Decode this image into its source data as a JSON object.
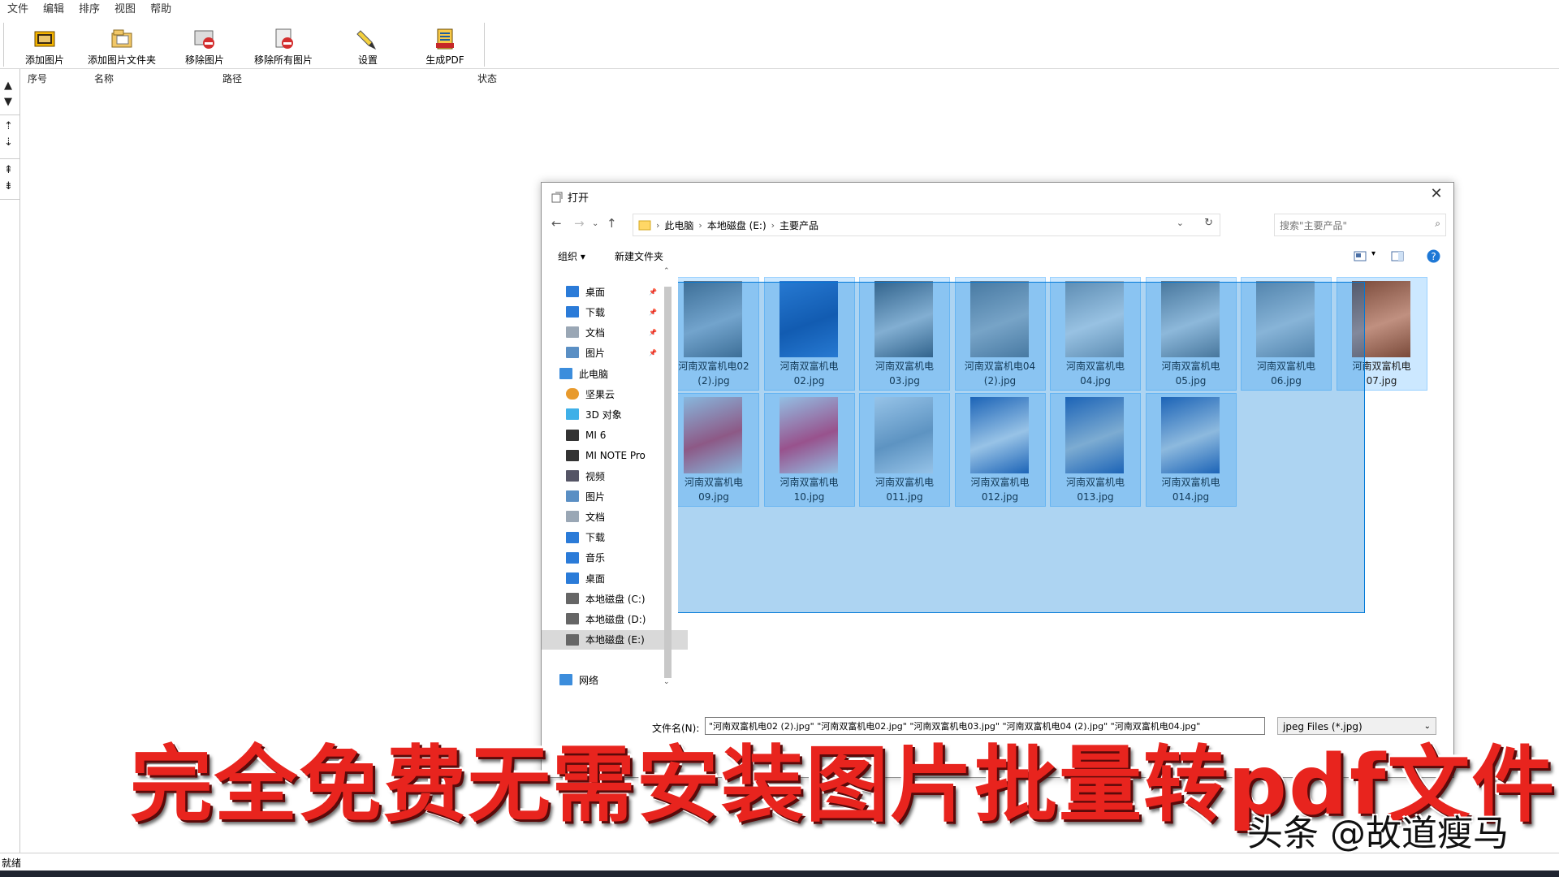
{
  "menu": [
    "文件",
    "编辑",
    "排序",
    "视图",
    "帮助"
  ],
  "toolbar": {
    "add_image": "添加图片",
    "add_folder": "添加图片文件夹",
    "remove_image": "移除图片",
    "remove_all": "移除所有图片",
    "settings": "设置",
    "generate_pdf": "生成PDF"
  },
  "arrows": [
    "▲",
    "▼",
    "⇡",
    "⇣",
    "⇞",
    "⇟"
  ],
  "columns": [
    "序号",
    "名称",
    "路径",
    "状态"
  ],
  "status": "就绪",
  "dialog": {
    "title": "打开",
    "close": "✕",
    "breadcrumbs": [
      "此电脑",
      "本地磁盘 (E:)",
      "主要产品"
    ],
    "search_placeholder": "搜索\"主要产品\"",
    "organize": "组织 ▾",
    "new_folder": "新建文件夹",
    "nav_quick": [
      {
        "label": "桌面",
        "icon": "desktop-icon"
      },
      {
        "label": "下载",
        "icon": "download-icon"
      },
      {
        "label": "文档",
        "icon": "document-icon"
      },
      {
        "label": "图片",
        "icon": "pictures-icon"
      }
    ],
    "nav_pc": [
      {
        "label": "此电脑",
        "icon": "pc-icon"
      },
      {
        "label": "坚果云",
        "icon": "cloud-icon"
      },
      {
        "label": "3D 对象",
        "icon": "3d-icon"
      },
      {
        "label": "MI 6",
        "icon": "phone-icon"
      },
      {
        "label": "MI NOTE Pro",
        "icon": "phone-icon"
      },
      {
        "label": "视频",
        "icon": "video-icon"
      },
      {
        "label": "图片",
        "icon": "pictures-icon"
      },
      {
        "label": "文档",
        "icon": "document-icon"
      },
      {
        "label": "下载",
        "icon": "download-icon"
      },
      {
        "label": "音乐",
        "icon": "music-icon"
      },
      {
        "label": "桌面",
        "icon": "desktop-icon"
      },
      {
        "label": "本地磁盘 (C:)",
        "icon": "drive-icon"
      },
      {
        "label": "本地磁盘 (D:)",
        "icon": "drive-icon"
      },
      {
        "label": "本地磁盘 (E:)",
        "icon": "drive-icon"
      }
    ],
    "nav_network": {
      "label": "网络",
      "icon": "network-icon"
    },
    "files": [
      {
        "line1": "河南双富机电02",
        "line2": "(2).jpg"
      },
      {
        "line1": "河南双富机电",
        "line2": "02.jpg"
      },
      {
        "line1": "河南双富机电",
        "line2": "03.jpg"
      },
      {
        "line1": "河南双富机电04",
        "line2": "(2).jpg"
      },
      {
        "line1": "河南双富机电",
        "line2": "04.jpg"
      },
      {
        "line1": "河南双富机电",
        "line2": "05.jpg"
      },
      {
        "line1": "河南双富机电",
        "line2": "06.jpg"
      },
      {
        "line1": "河南双富机电",
        "line2": "07.jpg"
      },
      {
        "line1": "河南双富机电",
        "line2": "09.jpg"
      },
      {
        "line1": "河南双富机电",
        "line2": "10.jpg"
      },
      {
        "line1": "河南双富机电",
        "line2": "011.jpg"
      },
      {
        "line1": "河南双富机电",
        "line2": "012.jpg"
      },
      {
        "line1": "河南双富机电",
        "line2": "013.jpg"
      },
      {
        "line1": "河南双富机电",
        "line2": "014.jpg"
      }
    ],
    "filename_label": "文件名(N):",
    "filename_value": "\"河南双富机电02 (2).jpg\" \"河南双富机电02.jpg\" \"河南双富机电03.jpg\" \"河南双富机电04 (2).jpg\" \"河南双富机电04.jpg\"",
    "filetype_value": "jpeg Files (*.jpg)"
  },
  "overlay_caption": "完全免费无需安装图片批量转pdf文件",
  "watermark": "头条 @故道瘦马",
  "colors": {
    "selection": "#cce8ff",
    "marquee": "#0078d7",
    "caption": "#e8241e"
  }
}
